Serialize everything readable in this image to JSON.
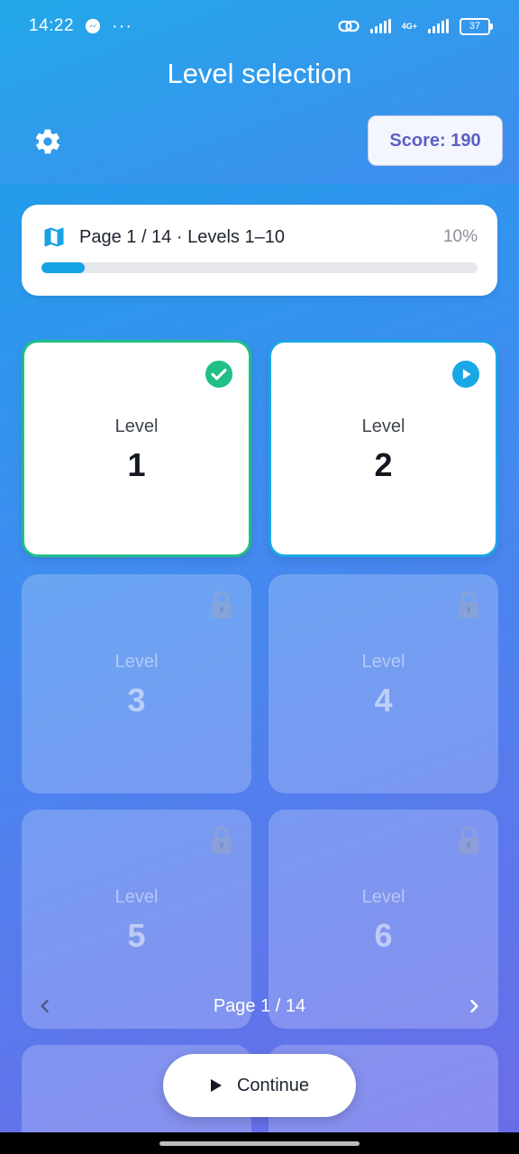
{
  "status_bar": {
    "time": "14:22",
    "battery": "37",
    "network": "4G+"
  },
  "header": {
    "title": "Level selection",
    "score": "Score: 190"
  },
  "progress": {
    "title": "Page 1 / 14 · Levels 1–10",
    "percent_label": "10%",
    "fraction": 0.1
  },
  "levels": [
    {
      "label": "Level",
      "number": "1",
      "state": "completed"
    },
    {
      "label": "Level",
      "number": "2",
      "state": "current"
    },
    {
      "label": "Level",
      "number": "3",
      "state": "locked"
    },
    {
      "label": "Level",
      "number": "4",
      "state": "locked"
    },
    {
      "label": "Level",
      "number": "5",
      "state": "locked"
    },
    {
      "label": "Level",
      "number": "6",
      "state": "locked"
    }
  ],
  "pager": {
    "label": "Page 1 / 14"
  },
  "continue": {
    "label": "Continue"
  },
  "colors": {
    "accent": "#17a2e4",
    "completed": "#1fbf86",
    "score_text": "#5b5fc7"
  }
}
